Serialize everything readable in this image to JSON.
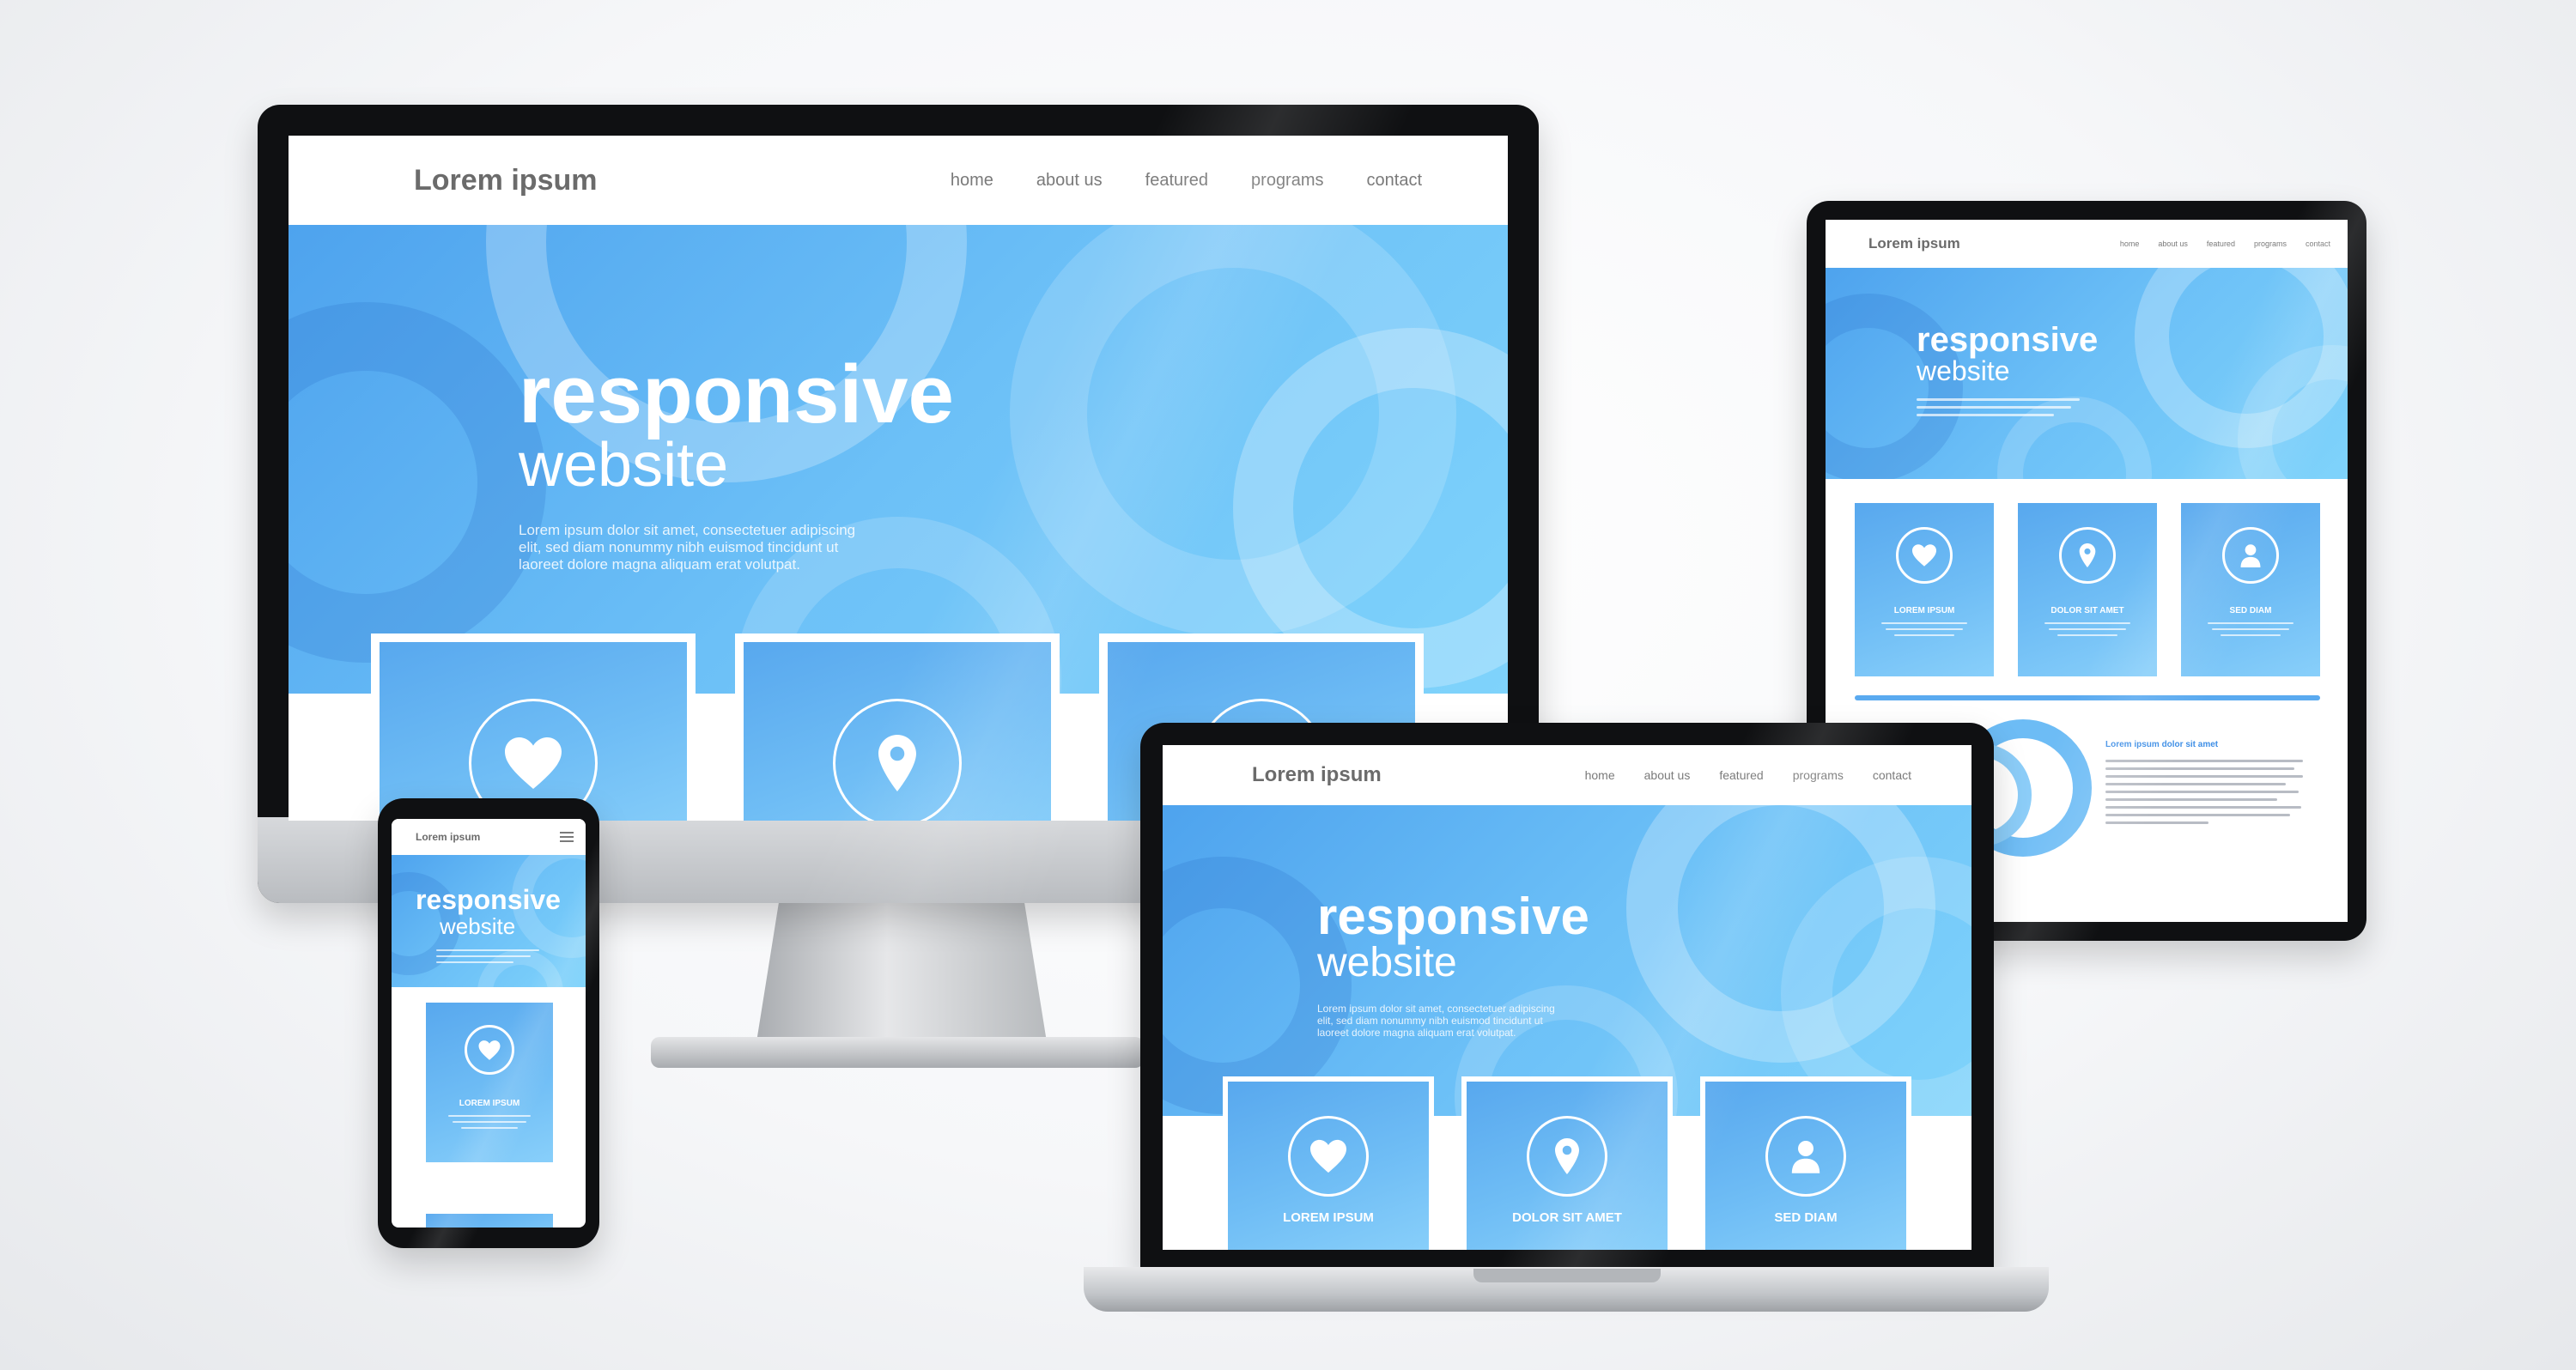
{
  "site": {
    "logo": "Lorem ipsum",
    "nav": [
      "home",
      "about us",
      "featured",
      "programs",
      "contact"
    ],
    "hero_title": "responsive",
    "hero_subtitle": "website",
    "hero_text_lines": [
      "Lorem ipsum dolor sit amet, consectetuer adipiscing",
      "elit, sed diam nonummy nibh euismod tincidunt ut",
      "laoreet dolore magna aliquam erat volutpat."
    ],
    "cards": [
      {
        "title": "LOREM IPSUM",
        "icon": "heart-icon"
      },
      {
        "title": "DOLOR SIT AMET",
        "icon": "location-pin-icon"
      },
      {
        "title": "SED DIAM",
        "icon": "user-icon"
      }
    ],
    "tablet_article_title": "Lorem ipsum dolor sit amet"
  },
  "colors": {
    "accent_blue": "#4ea3ee",
    "light_blue": "#7fd3fb",
    "bezel": "#0f1012",
    "text_gray": "#6b6b6b"
  }
}
